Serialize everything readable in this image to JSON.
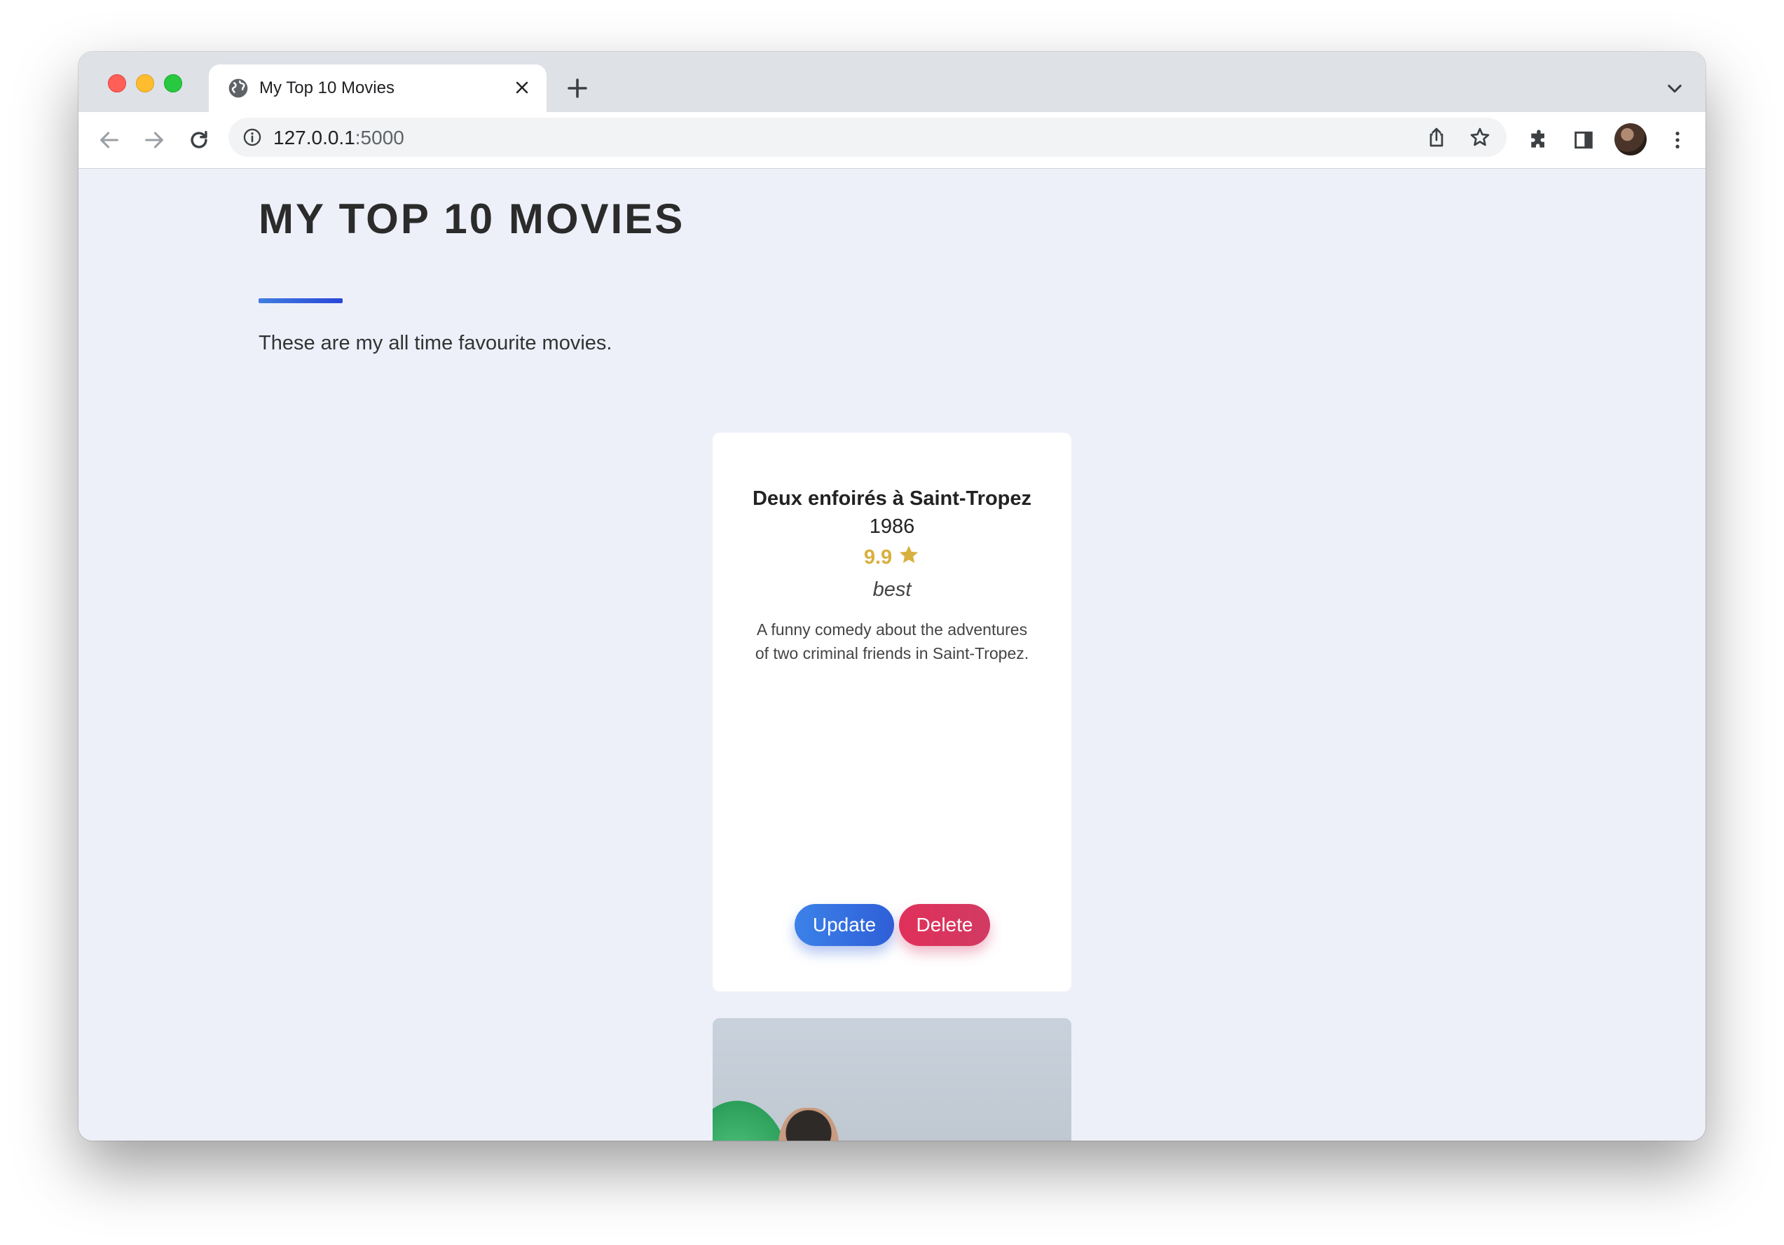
{
  "browser": {
    "tab_title": "My Top 10 Movies",
    "url_host": "127.0.0.1",
    "url_port": ":5000"
  },
  "page": {
    "heading": "MY TOP 10 MOVIES",
    "intro": "These are my all time favourite movies.",
    "accent_color": "#2f5fd8"
  },
  "movies": [
    {
      "title": "Deux enfoirés à Saint-Tropez",
      "year": "1986",
      "rating": "9.9",
      "review": "best",
      "description": "A funny comedy about the adventures of two criminal friends in Saint-Tropez.",
      "update_label": "Update",
      "delete_label": "Delete",
      "rating_color": "#d8b03f",
      "update_color": "#3b82e8",
      "delete_color": "#e0305a"
    }
  ],
  "icons": {
    "tab_favicon": "globe-icon",
    "tab_close": "close-icon",
    "new_tab": "plus-icon",
    "tab_menu": "chevron-down-icon",
    "back": "arrow-left-icon",
    "forward": "arrow-right-icon",
    "reload": "reload-icon",
    "site_info": "info-icon",
    "share": "share-icon",
    "bookmark": "star-outline-icon",
    "extensions": "puzzle-icon",
    "side_panel": "side-panel-icon",
    "menu": "kebab-menu-icon",
    "rating_star": "star-icon"
  }
}
